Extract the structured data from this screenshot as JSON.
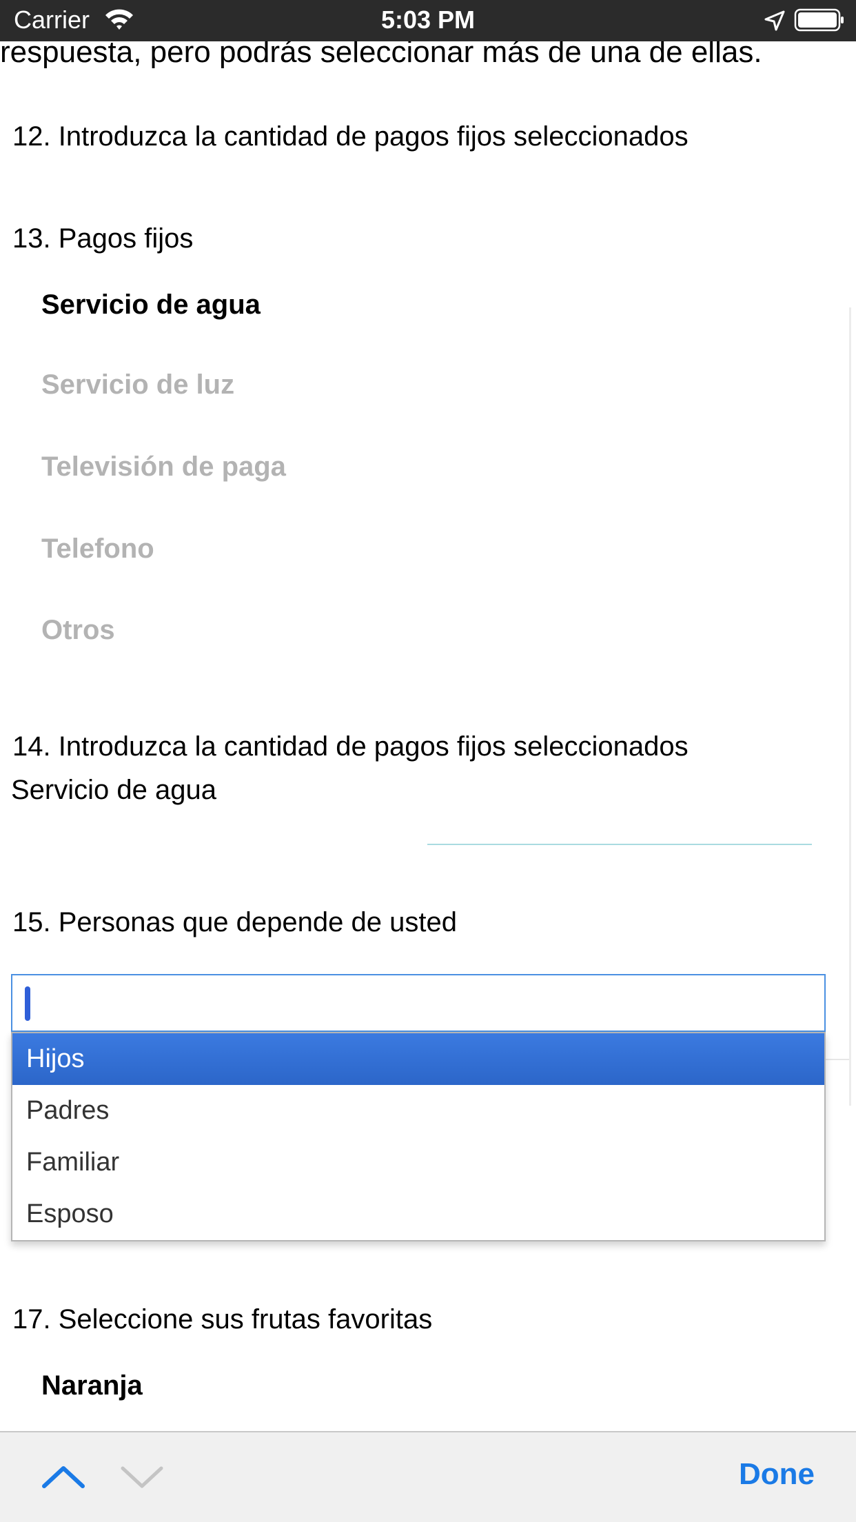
{
  "status_bar": {
    "carrier": "Carrier",
    "time": "5:03 PM"
  },
  "intro_text": "respuesta, pero podrás seleccionar más de una de ellas.",
  "q12": {
    "label": "12. Introduzca la cantidad de pagos fijos seleccionados"
  },
  "q13": {
    "label": "13. Pagos fijos",
    "options": [
      {
        "label": "Servicio de agua",
        "selected": true
      },
      {
        "label": "Servicio de luz",
        "selected": false
      },
      {
        "label": "Televisión de paga",
        "selected": false
      },
      {
        "label": "Telefono",
        "selected": false
      },
      {
        "label": "Otros",
        "selected": false
      }
    ]
  },
  "q14": {
    "label": "14. Introduzca la cantidad de pagos fijos seleccionados",
    "sublabel": "Servicio de agua",
    "value": ""
  },
  "q15": {
    "label": "15. Personas que depende de usted",
    "input_value": "",
    "dropdown_options": [
      {
        "label": "Hijos",
        "highlighted": true
      },
      {
        "label": "Padres",
        "highlighted": false
      },
      {
        "label": "Familiar",
        "highlighted": false
      },
      {
        "label": "Esposo",
        "highlighted": false
      }
    ]
  },
  "q17": {
    "label": "17. Seleccione sus frutas favoritas",
    "options": [
      {
        "label": "Naranja",
        "selected": true
      }
    ]
  },
  "toolbar": {
    "done_label": "Done",
    "up_icon": "chevron-up-icon",
    "down_icon": "chevron-down-icon"
  },
  "colors": {
    "accent": "#1a7ae6",
    "highlight": "#3b7ae0",
    "dim_text": "#b3b3b3",
    "status_bar": "#2b2b2b"
  }
}
